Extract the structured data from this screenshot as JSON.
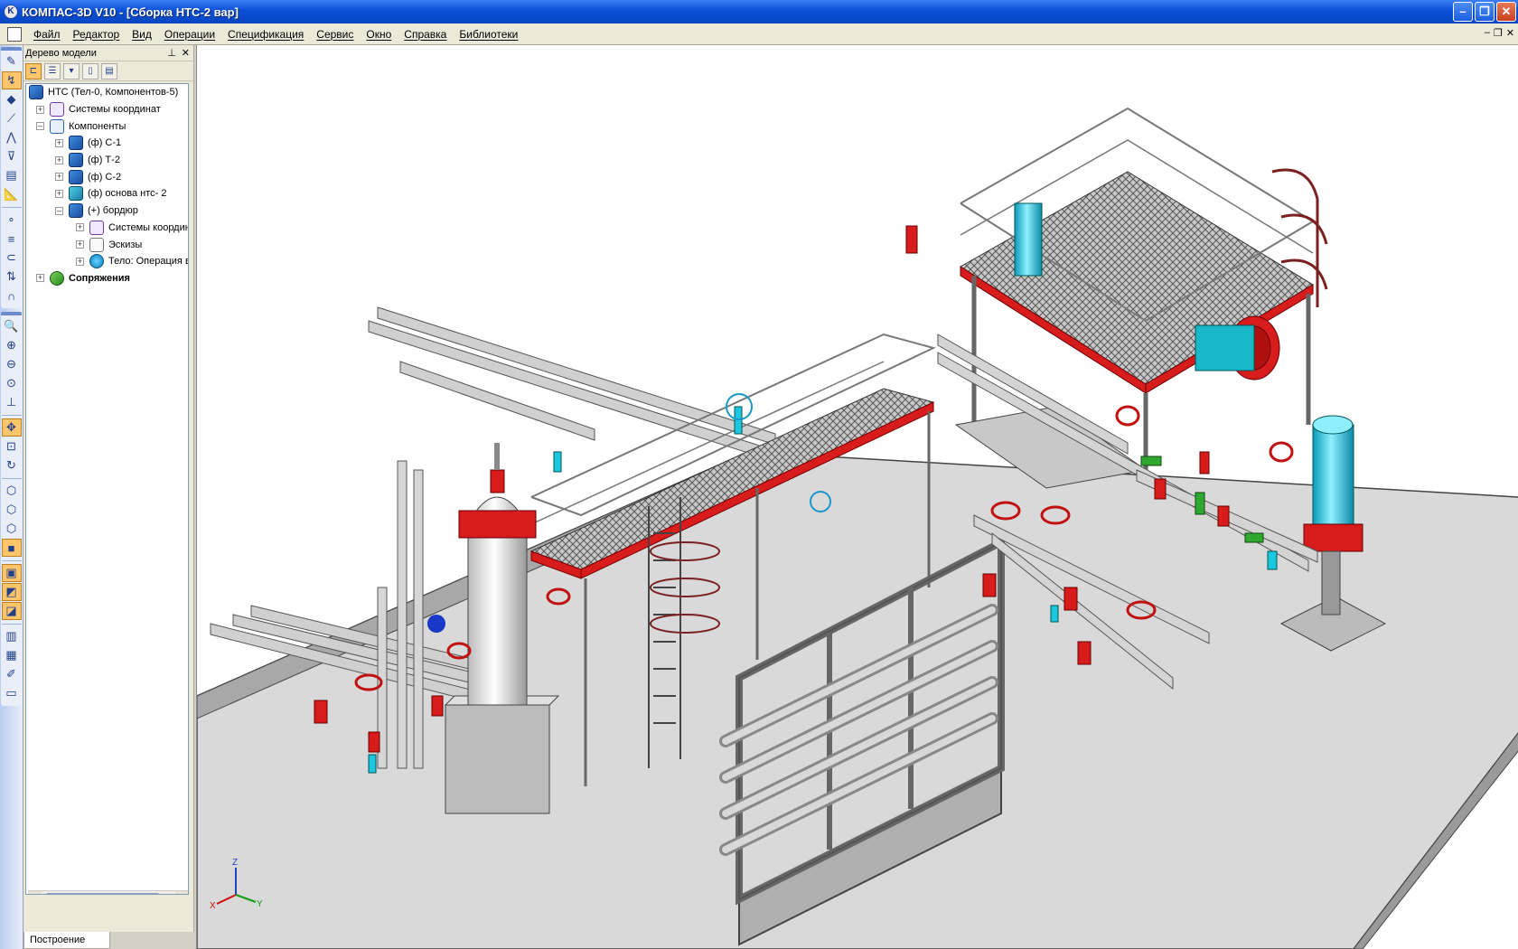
{
  "titlebar": {
    "title": "КОМПАС-3D V10 - [Сборка НТС-2 вар]",
    "app_icon": "kompas-logo-icon",
    "buttons": [
      "minimize",
      "maximize",
      "close"
    ]
  },
  "menu": {
    "items": [
      "Файл",
      "Редактор",
      "Вид",
      "Операции",
      "Спецификация",
      "Сервис",
      "Окно",
      "Справка",
      "Библиотеки"
    ]
  },
  "panel": {
    "title": "Дерево модели",
    "tree": {
      "root": "НТС (Тел-0, Компонентов-5)",
      "coord_systems": "Системы координат",
      "components": "Компоненты",
      "c1": "(ф) С-1",
      "t2": "(ф) Т-2",
      "c2": "(ф) С-2",
      "base": "(ф) основа нтс- 2",
      "border": "(+) бордюр",
      "border_coord": "Системы координа",
      "sketches": "Эскизы",
      "body": "Тело:  Операция в",
      "mates": "Сопряжения"
    }
  },
  "status": {
    "tab": "Построение"
  },
  "axes": {
    "x": "X",
    "y": "Y",
    "z": "Z"
  },
  "colors": {
    "titlebar": "#0a4fd6",
    "accent_red": "#d81c1c",
    "accent_cyan": "#1cc8e0",
    "steel": "#c8c8c8",
    "floor": "#d8d8d8"
  }
}
